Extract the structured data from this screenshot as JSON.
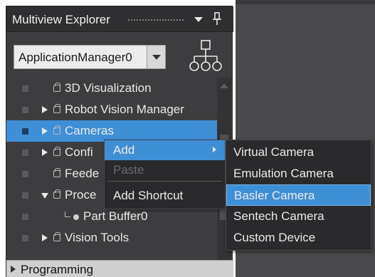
{
  "panel": {
    "title": "Multiview Explorer",
    "selector_value": "ApplicationManager0"
  },
  "tree": {
    "items": [
      {
        "label": "3D Visualization",
        "expand": "none"
      },
      {
        "label": "Robot Vision Manager",
        "expand": "collapsed"
      },
      {
        "label": "Cameras",
        "expand": "collapsed",
        "selected": true
      },
      {
        "label": "Confi",
        "expand": "collapsed"
      },
      {
        "label": "Feede",
        "expand": "none"
      },
      {
        "label": "Proce",
        "expand": "expanded"
      },
      {
        "label": "Part Buffer0",
        "expand": "leaf"
      },
      {
        "label": "Vision Tools",
        "expand": "collapsed"
      }
    ],
    "footer_section": "Programming"
  },
  "context_menu": {
    "items": [
      {
        "label": "Add",
        "state": "active",
        "has_submenu": true
      },
      {
        "label": "Paste",
        "state": "disabled"
      },
      {
        "label": "Add Shortcut",
        "state": "normal"
      }
    ]
  },
  "submenu": {
    "items": [
      {
        "label": "Virtual Camera"
      },
      {
        "label": "Emulation Camera"
      },
      {
        "label": "Basler Camera",
        "hover": true
      },
      {
        "label": "Sentech Camera"
      },
      {
        "label": "Custom Device"
      }
    ]
  },
  "icons": {
    "hierarchy": "hierarchy-tree-icon",
    "pin": "pin-icon",
    "node": "folder-node-icon"
  },
  "colors": {
    "panel_bg": "#3d3d40",
    "selection": "#3f8fd6",
    "menu_bg": "#2a2a2d",
    "workspace": "#4a4a4c"
  }
}
